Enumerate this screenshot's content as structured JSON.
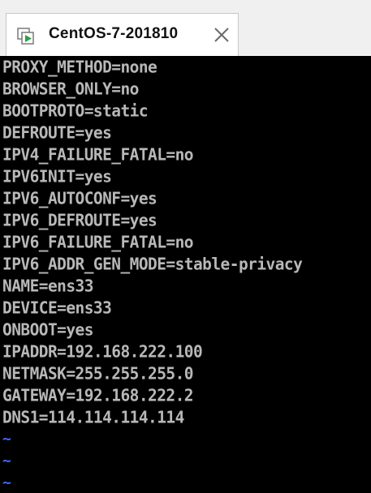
{
  "tab": {
    "title": "CentOS-7-201810",
    "icon": "vm-running-icon",
    "close_icon": "close-icon"
  },
  "console": {
    "lines": [
      "PROXY_METHOD=none",
      "BROWSER_ONLY=no",
      "BOOTPROTO=static",
      "DEFROUTE=yes",
      "IPV4_FAILURE_FATAL=no",
      "IPV6INIT=yes",
      "IPV6_AUTOCONF=yes",
      "IPV6_DEFROUTE=yes",
      "IPV6_FAILURE_FATAL=no",
      "IPV6_ADDR_GEN_MODE=stable-privacy",
      "NAME=ens33",
      "DEVICE=ens33",
      "ONBOOT=yes",
      "IPADDR=192.168.222.100",
      "NETMASK=255.255.255.0",
      "GATEWAY=192.168.222.2",
      "DNS1=114.114.114.114"
    ],
    "empty_markers": [
      "~",
      "~",
      "~"
    ],
    "text_color": "#b8b8b8",
    "marker_color": "#3a6cff",
    "background": "#000000"
  }
}
